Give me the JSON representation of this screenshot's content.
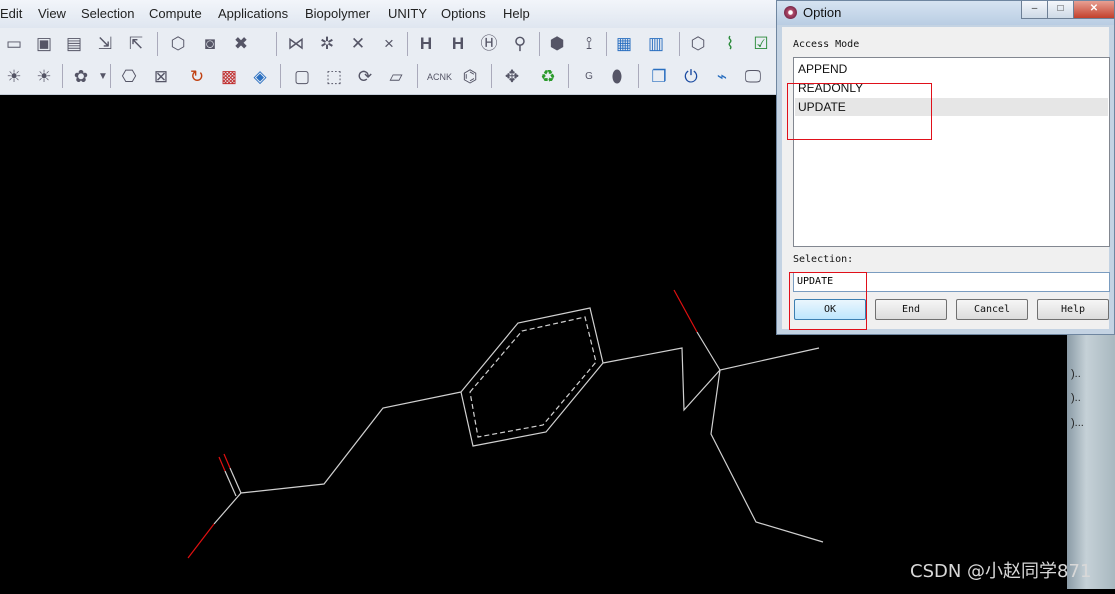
{
  "menu": [
    "Edit",
    "View",
    "Selection",
    "Compute",
    "Applications",
    "Biopolymer",
    "UNITY",
    "Options",
    "Help"
  ],
  "dialog": {
    "title": "Option",
    "minimize": "–",
    "maximize": "□",
    "close": "✕",
    "access_mode_label": "Access Mode",
    "options": [
      "APPEND",
      "READONLY",
      "UPDATE"
    ],
    "selected_option": "UPDATE",
    "selection_label": "Selection:",
    "selection_value": "UPDATE",
    "buttons": {
      "ok": "OK",
      "end": "End",
      "cancel": "Cancel",
      "help": "Help"
    }
  },
  "right_strip_texts": [
    ")..",
    ")..",
    ")..."
  ],
  "watermark": "CSDN @小赵同学871",
  "colors": {
    "viewport": "#000000",
    "bond": "#d0d0d0",
    "oxygen": "#e01010",
    "highlight": "#e0101a"
  }
}
